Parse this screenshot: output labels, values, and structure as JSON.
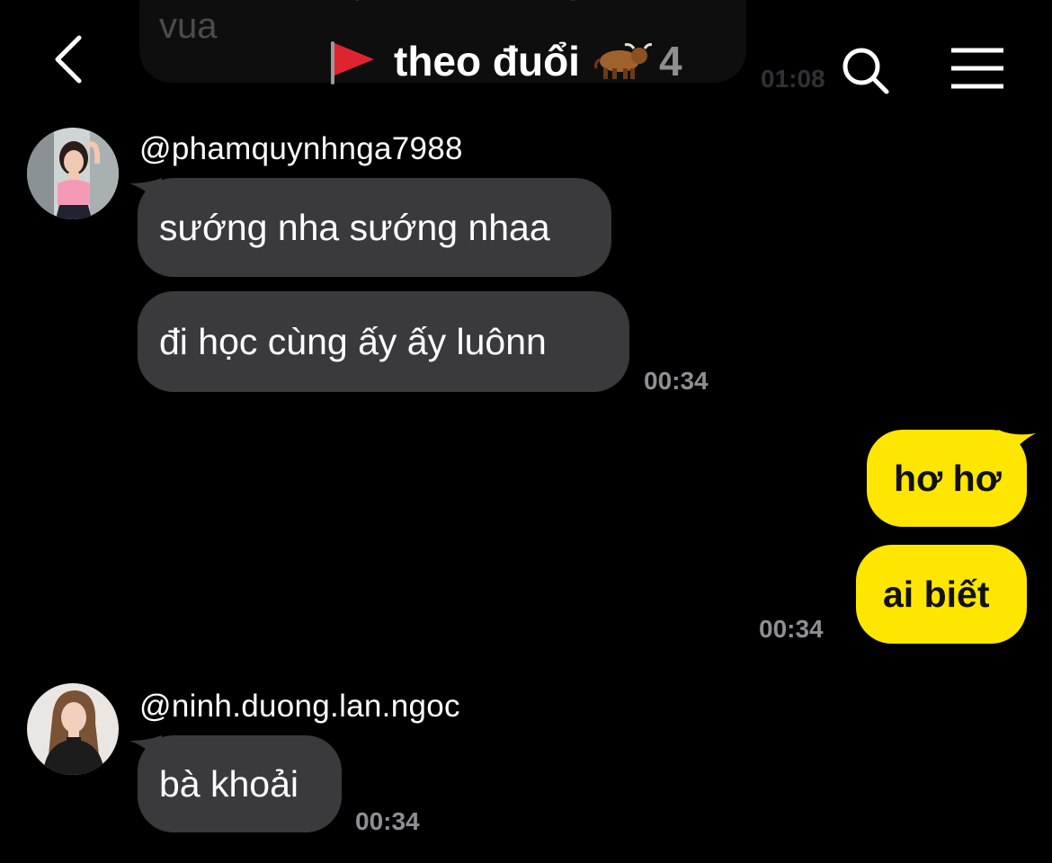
{
  "header": {
    "title": "theo đuổi",
    "member_count": "4",
    "icons": [
      "back-chevron-icon",
      "red-flag-icon",
      "ox-icon",
      "search-icon",
      "menu-icon"
    ]
  },
  "ghost": {
    "text": "ai có ảnh cấp màn hình ng đó là vua",
    "time": "01:08"
  },
  "messages": [
    {
      "sender": "@phamquynhnga7988",
      "bubbles": [
        "sướng nha sướng nhaa",
        "đi học cùng ấy ấy luônn"
      ],
      "time": "00:34"
    },
    {
      "sender": "me",
      "bubbles": [
        "hơ hơ",
        "ai biết"
      ],
      "time": "00:34"
    },
    {
      "sender": "@ninh.duong.lan.ngoc",
      "bubbles": [
        "bà khoải"
      ],
      "time": "00:34"
    }
  ],
  "colors": {
    "background": "#000000",
    "incoming_bubble": "#3a3a3c",
    "outgoing_bubble": "#ffe600",
    "timestamp": "#8e8e93"
  }
}
